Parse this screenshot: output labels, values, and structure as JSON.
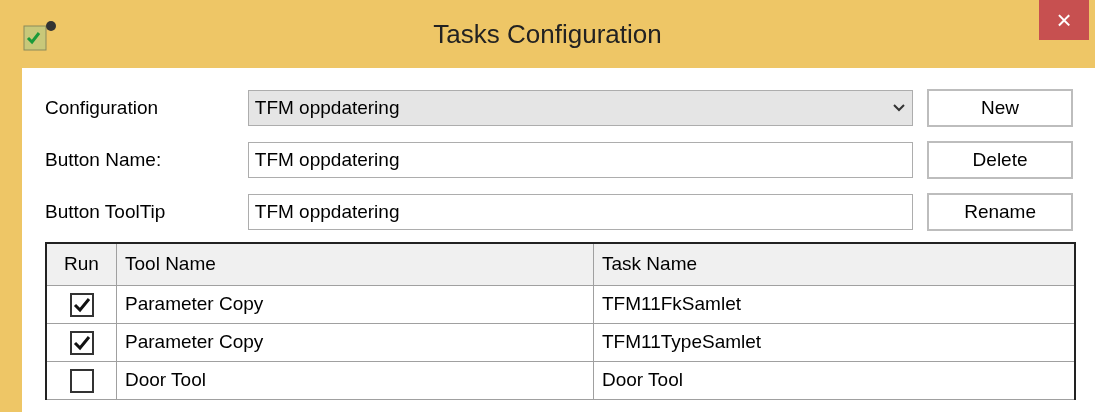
{
  "window": {
    "title": "Tasks Configuration",
    "close": "×"
  },
  "form": [
    {
      "kind": "select",
      "label": "Configuration",
      "value": "TFM oppdatering",
      "button": "New"
    },
    {
      "kind": "text",
      "label": "Button Name:",
      "value": "TFM oppdatering",
      "button": "Delete"
    },
    {
      "kind": "text",
      "label": "Button ToolTip",
      "value": "TFM oppdatering",
      "button": "Rename"
    }
  ],
  "table": {
    "columns": [
      "Run",
      "Tool Name",
      "Task Name"
    ],
    "rows": [
      {
        "checked": true,
        "tool": "Parameter Copy",
        "task": "TFM11FkSamlet"
      },
      {
        "checked": true,
        "tool": "Parameter Copy",
        "task": "TFM11TypeSamlet"
      },
      {
        "checked": false,
        "tool": "Door Tool",
        "task": "Door Tool"
      }
    ]
  }
}
